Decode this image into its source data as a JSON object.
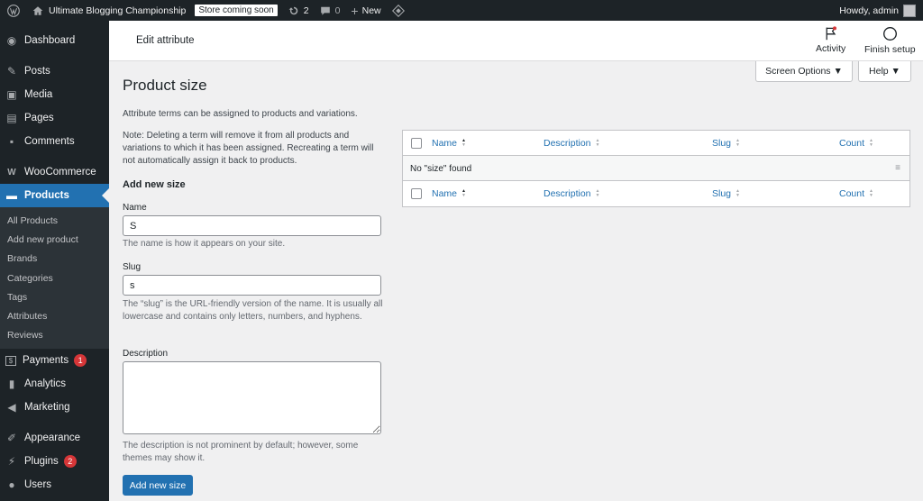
{
  "adminbar": {
    "site_name": "Ultimate Blogging Championship",
    "store_badge": "Store coming soon",
    "updates_count": "2",
    "comments_count": "0",
    "new_label": "New",
    "greeting": "Howdy, admin"
  },
  "sidebar": {
    "items": [
      {
        "label": "Dashboard",
        "icon": "dashboard-icon"
      },
      {
        "label": "Posts",
        "icon": "pin-icon"
      },
      {
        "label": "Media",
        "icon": "media-icon"
      },
      {
        "label": "Pages",
        "icon": "pages-icon"
      },
      {
        "label": "Comments",
        "icon": "comment-icon"
      },
      {
        "label": "WooCommerce",
        "icon": "woo-icon"
      },
      {
        "label": "Products",
        "icon": "archive-icon"
      },
      {
        "label": "Payments",
        "icon": "payments-icon",
        "badge": "1"
      },
      {
        "label": "Analytics",
        "icon": "chart-icon"
      },
      {
        "label": "Marketing",
        "icon": "megaphone-icon"
      },
      {
        "label": "Appearance",
        "icon": "brush-icon"
      },
      {
        "label": "Plugins",
        "icon": "plug-icon",
        "badge": "2"
      },
      {
        "label": "Users",
        "icon": "user-icon"
      }
    ],
    "products_submenu": [
      "All Products",
      "Add new product",
      "Brands",
      "Categories",
      "Tags",
      "Attributes",
      "Reviews"
    ]
  },
  "header": {
    "title": "Edit attribute",
    "activity_label": "Activity",
    "finish_setup_label": "Finish setup"
  },
  "screen_options": {
    "label": "Screen Options ▼"
  },
  "help": {
    "label": "Help ▼"
  },
  "main": {
    "title": "Product size",
    "intro": "Attribute terms can be assigned to products and variations.",
    "note": "Note: Deleting a term will remove it from all products and variations to which it has been assigned. Recreating a term will not automatically assign it back to products.",
    "form_title": "Add new size",
    "name_label": "Name",
    "name_value": "S",
    "name_desc": "The name is how it appears on your site.",
    "slug_label": "Slug",
    "slug_value": "s",
    "slug_desc": "The “slug” is the URL-friendly version of the name. It is usually all lowercase and contains only letters, numbers, and hyphens.",
    "description_label": "Description",
    "description_value": "",
    "description_desc": "The description is not prominent by default; however, some themes may show it.",
    "submit_label": "Add new size"
  },
  "table": {
    "columns": [
      "Name",
      "Description",
      "Slug",
      "Count"
    ],
    "empty_message": "No \"size\" found"
  },
  "colors": {
    "accent": "#2271b1",
    "sidebar_bg": "#1d2327",
    "badge": "#d63638"
  }
}
